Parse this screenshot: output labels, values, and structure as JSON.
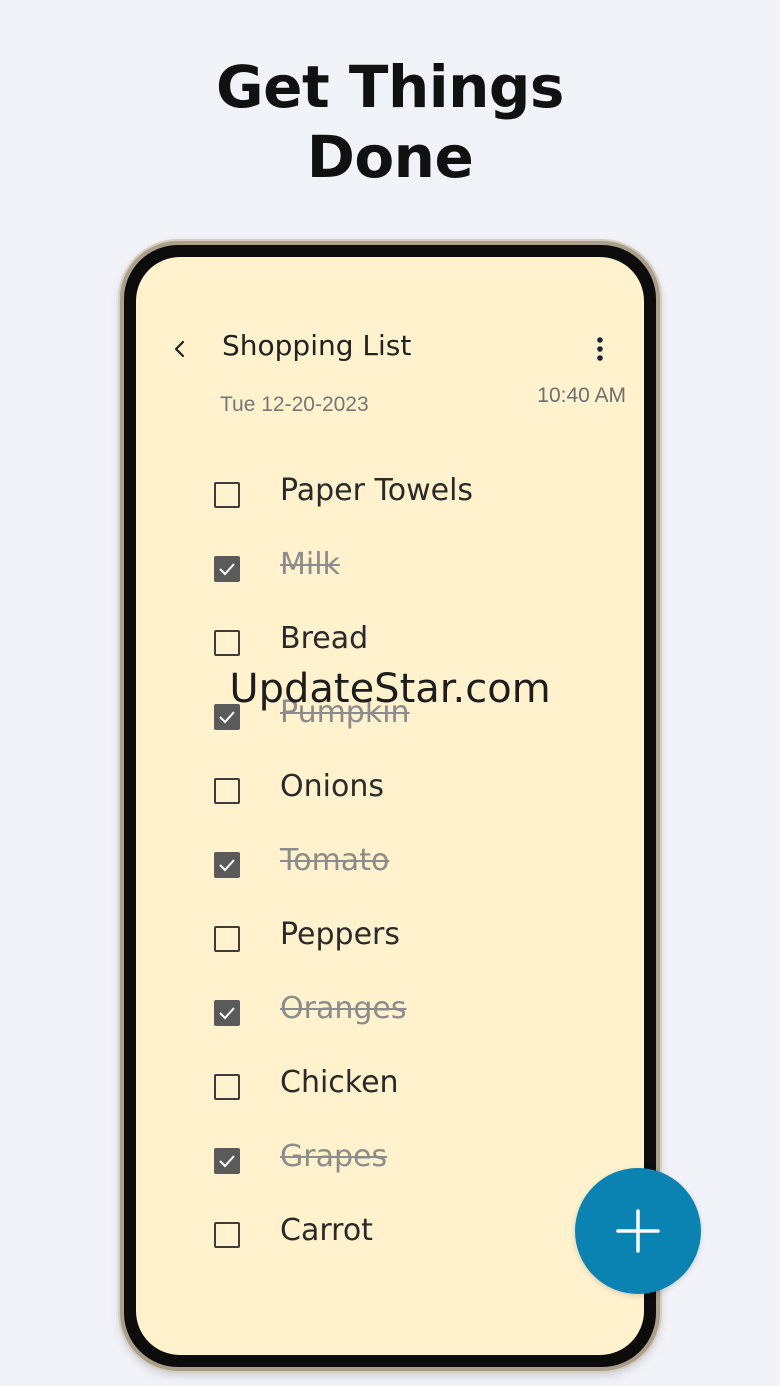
{
  "headline": {
    "line1": "Get Things",
    "line2": "Done"
  },
  "note": {
    "title": "Shopping List",
    "date": "Tue 12-20-2023",
    "time": "10:40 AM"
  },
  "items": [
    {
      "label": "Paper Towels",
      "checked": false
    },
    {
      "label": "Milk",
      "checked": true
    },
    {
      "label": "Bread",
      "checked": false
    },
    {
      "label": "Pumpkin",
      "checked": true
    },
    {
      "label": "Onions",
      "checked": false
    },
    {
      "label": "Tomato",
      "checked": true
    },
    {
      "label": "Peppers",
      "checked": false
    },
    {
      "label": "Oranges",
      "checked": true
    },
    {
      "label": "Chicken",
      "checked": false
    },
    {
      "label": "Grapes",
      "checked": true
    },
    {
      "label": "Carrot",
      "checked": false
    }
  ],
  "watermark": "UpdateStar.com",
  "icons": {
    "back": "chevron-left-icon",
    "menu": "more-vertical-icon",
    "check": "checkmark-icon",
    "add": "plus-icon"
  },
  "colors": {
    "background": "#f1f3f9",
    "note_background": "#fff2cd",
    "fab": "#0a83b3",
    "checked_box": "#5a5a5a"
  }
}
